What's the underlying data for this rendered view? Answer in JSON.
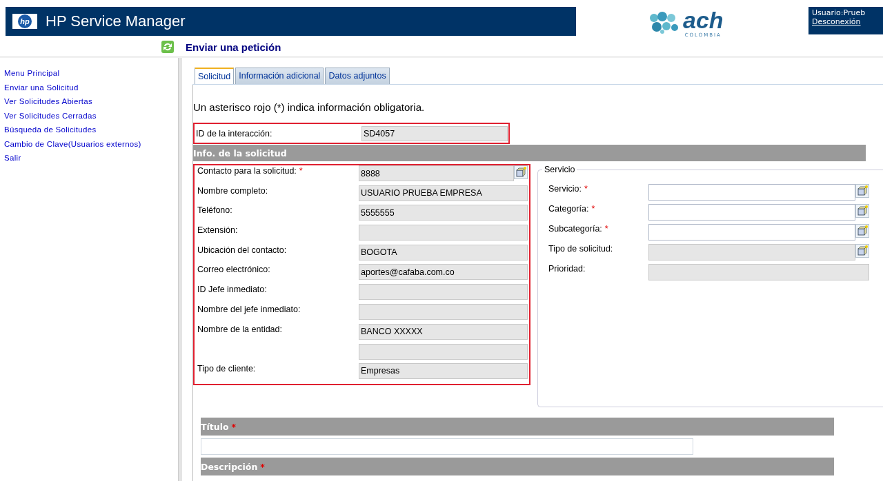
{
  "header": {
    "product": "HP Service Manager",
    "logo_text": "hp",
    "partner_logo": "ach",
    "partner_tagline": "COLOMBIA",
    "user": "Usuario:Prueb",
    "logout": "Desconexión"
  },
  "page_title": "Enviar una petición",
  "sidebar": {
    "items": [
      {
        "label": "Menu Principal"
      },
      {
        "label": "Enviar una Solicitud"
      },
      {
        "label": "Ver Solicitudes Abiertas"
      },
      {
        "label": "Ver Solicitudes Cerradas"
      },
      {
        "label": "Búsqueda de Solicitudes"
      },
      {
        "label": "Cambio de Clave(Usuarios externos)"
      },
      {
        "label": "Salir"
      }
    ]
  },
  "tabs": [
    {
      "label": "Solicitud",
      "selected": true
    },
    {
      "label": "Información adicional",
      "selected": false
    },
    {
      "label": "Datos adjuntos",
      "selected": false
    }
  ],
  "instruction": "Un asterisco rojo (*) indica información obligatoria.",
  "id_row": {
    "label": "ID de la interacción:",
    "value": "SD4057",
    "highlighted": true
  },
  "section_title": "Info. de la solicitud",
  "contact": {
    "highlighted": true,
    "fields": [
      {
        "label": "Contacto para la solicitud:",
        "value": "8888",
        "required_mark": "*",
        "lookup": true,
        "editable": false
      },
      {
        "label": "Nombre completo:",
        "value": "USUARIO PRUEBA EMPRESA",
        "editable": false
      },
      {
        "label": "Teléfono:",
        "value": "5555555",
        "editable": false
      },
      {
        "label": "Extensión:",
        "editable": false
      },
      {
        "label": "Ubicación del contacto:",
        "value": "BOGOTA",
        "editable": false
      },
      {
        "label": "Correo electrónico:",
        "value": "aportes@cafaba.com.co",
        "editable": false
      },
      {
        "label": "ID Jefe inmediato:",
        "editable": false
      },
      {
        "label": "Nombre del jefe inmediato:",
        "editable": false
      },
      {
        "label": "Nombre de la entidad:",
        "value": "BANCO XXXXX",
        "editable": false,
        "second_box": true
      },
      {
        "label": "Tipo de cliente:",
        "value": "Empresas",
        "editable": false
      }
    ]
  },
  "service": {
    "legend": "Servicio",
    "fields": [
      {
        "label": "Servicio:",
        "required_mark": "*",
        "lookup": true,
        "editable": true
      },
      {
        "label": "Categoría:",
        "required_mark": "*",
        "lookup": true,
        "editable": true
      },
      {
        "label": "Subcategoría:",
        "required_mark": "*",
        "lookup": true,
        "editable": true
      },
      {
        "label": "Tipo de solicitud:",
        "lookup": true,
        "editable": false
      },
      {
        "label": "Prioridad:",
        "editable": false
      }
    ]
  },
  "title_section": {
    "label": "Título",
    "required_mark": "*"
  },
  "description_section": {
    "label": "Descripción",
    "required_mark": "*"
  }
}
